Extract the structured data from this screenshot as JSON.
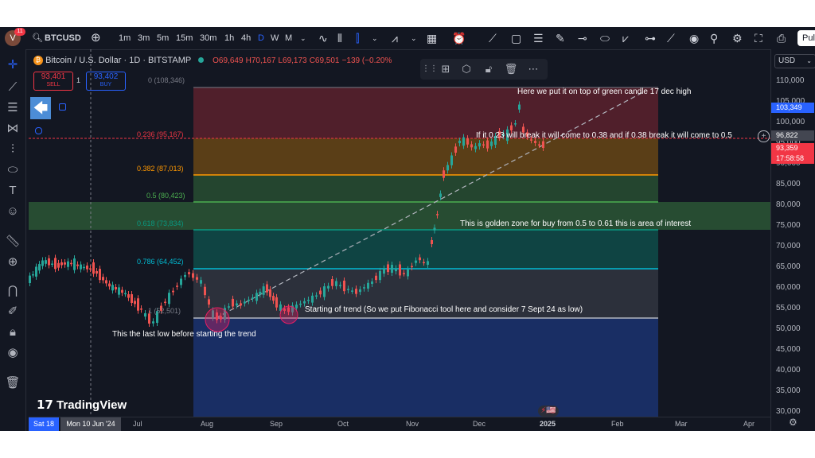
{
  "toolbar": {
    "avatar_letter": "V",
    "notification_count": "11",
    "symbol": "BTCUSD",
    "intervals": [
      "1m",
      "3m",
      "5m",
      "15m",
      "30m",
      "1h",
      "4h",
      "D",
      "W",
      "M"
    ],
    "active_interval": "D",
    "publish_label": "Pul"
  },
  "legend": {
    "title": "Bitcoin / U.S. Dollar · 1D · BITSTAMP",
    "open": "O69,649",
    "high": "H70,167",
    "low": "L69,173",
    "close": "C69,501",
    "change": "−139 (−0.20%"
  },
  "sell": {
    "price": "93,401",
    "label": "SELL"
  },
  "buy": {
    "price": "93,402",
    "label": "BUY"
  },
  "spread": "1",
  "currency": "USD",
  "watermark": "TradingView",
  "fib_levels": [
    {
      "label": "0 (108,346)",
      "color": "#787b86"
    },
    {
      "label": "0.236 (95,167)",
      "color": "#f23645"
    },
    {
      "label": "0.382 (87,013)",
      "color": "#ff9800"
    },
    {
      "label": "0.5 (80,423)",
      "color": "#4caf50"
    },
    {
      "label": "0.618 (73,834)",
      "color": "#089981"
    },
    {
      "label": "0.786 (64,452)",
      "color": "#00bcd4"
    },
    {
      "label": "1 (52,501)",
      "color": "#787b86"
    }
  ],
  "annotations": {
    "top": "Here we put it on top of green candle 17 dec high",
    "mid": "If it 0.23 will break it will come to 0.38 and if 0.38 break it will come to 0.5",
    "golden": "This is golden zone for buy from 0.5 to 0.61 this is area of interest",
    "start": "Starting of trend (So we put Fibonacci tool here and consider 7 Sept 24 as low)",
    "lastlow": "This the last low before starting the trend"
  },
  "price_axis": {
    "labels": [
      "110,000",
      "105,000",
      "100,000",
      "95,000",
      "90,000",
      "85,000",
      "80,000",
      "75,000",
      "70,000",
      "65,000",
      "60,000",
      "55,000",
      "50,000",
      "45,000",
      "40,000",
      "35,000",
      "30,000"
    ],
    "tag_blue": "103,349",
    "tag_gray": "96,822",
    "tag_red": "93,359",
    "countdown": "17:58:58"
  },
  "time_axis": {
    "cursor_date": "Sat 18",
    "crosshair_date": "Mon 10 Jun '24",
    "months": [
      "Jul",
      "Aug",
      "Sep",
      "Oct",
      "Nov",
      "Dec",
      "2025",
      "Feb",
      "Mar",
      "Apr"
    ]
  },
  "colors": {
    "background": "#131722",
    "accent": "#2962ff",
    "up": "#26a69a",
    "down": "#ef5350"
  }
}
